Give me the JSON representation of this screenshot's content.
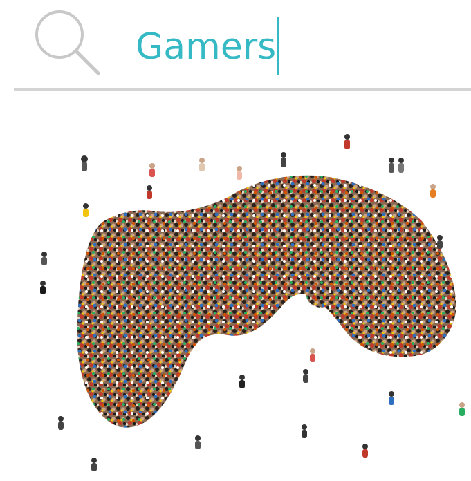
{
  "search": {
    "query": "Gamers",
    "icon": "search-icon"
  },
  "colors": {
    "accent": "#35b9c4",
    "divider": "#d4d4d4",
    "icon": "#c8c8c8"
  },
  "hero": {
    "icon": "game-controller-crowd-image"
  }
}
